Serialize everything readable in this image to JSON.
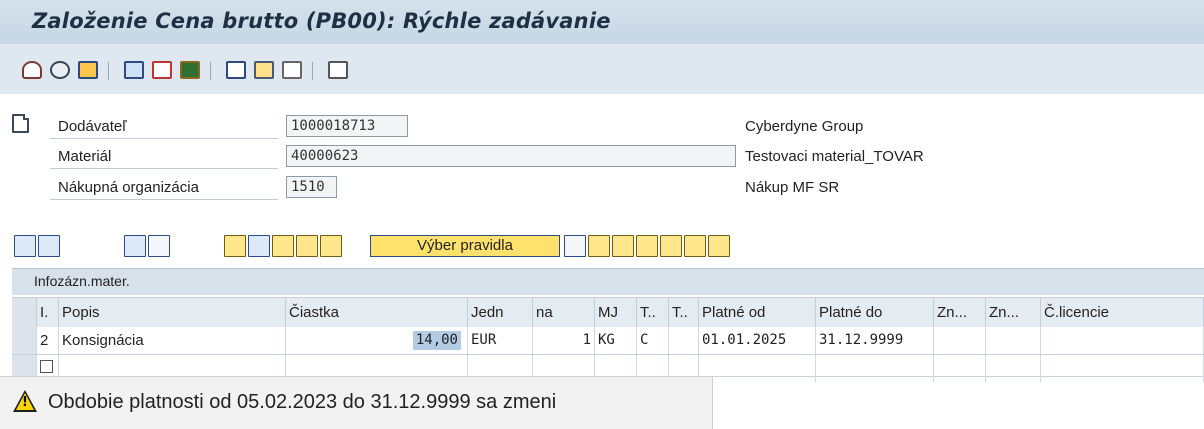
{
  "window": {
    "title": "Založenie Cena brutto (PB00): Rýchle zadávanie"
  },
  "header": {
    "vendor": {
      "label": "Dodávateľ",
      "value": "1000018713",
      "desc": "Cyberdyne Group"
    },
    "material": {
      "label": "Materiál",
      "value": "40000623",
      "desc": "Testovaci material_TOVAR"
    },
    "purch_org": {
      "label": "Nákupná organizácia",
      "value": "1510",
      "desc": "Nákup MF SR"
    }
  },
  "table_toolbar": {
    "rule_button": "Výber pravidla"
  },
  "grid": {
    "title": "Infozázn.mater.",
    "columns": [
      "I.",
      "Popis",
      "Čiastka",
      "Jedn",
      "na",
      "MJ",
      "T..",
      "T..",
      "Platné od",
      "Platné do",
      "Zn...",
      "Zn...",
      "Č.licencie"
    ],
    "rows": [
      {
        "i": "2",
        "popis": "Konsignácia",
        "ciastka": "14,00",
        "jedn": "EUR",
        "na": "1",
        "mj": "KG",
        "t1": "C",
        "t2": "",
        "od": "01.01.2025",
        "do": "31.12.9999"
      }
    ]
  },
  "status": {
    "type": "warning",
    "message": "Obdobie platnosti od 05.02.2023 do 31.12.9999 sa zmeni"
  },
  "colors": {
    "title_bg": "#c9d8e5",
    "accent_yellow": "#ffe26b",
    "selected_amount": "#b3cbe3"
  }
}
